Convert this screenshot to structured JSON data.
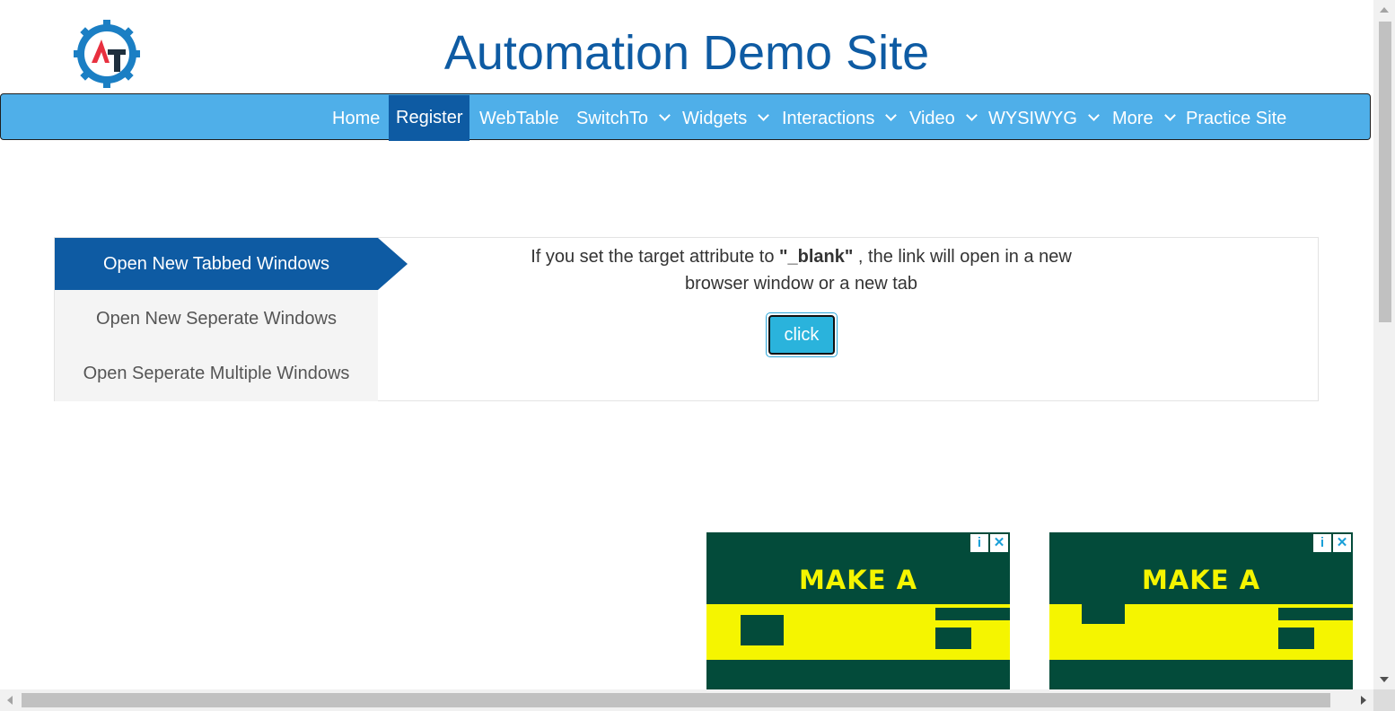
{
  "header": {
    "title": "Automation Demo Site",
    "logo_text": "AT"
  },
  "nav": {
    "items": [
      {
        "label": "Home",
        "dropdown": false,
        "active": false
      },
      {
        "label": "Register",
        "dropdown": false,
        "active": true
      },
      {
        "label": "WebTable",
        "dropdown": false,
        "active": false
      },
      {
        "label": "SwitchTo",
        "dropdown": true,
        "active": false
      },
      {
        "label": "Widgets",
        "dropdown": true,
        "active": false
      },
      {
        "label": "Interactions",
        "dropdown": true,
        "active": false
      },
      {
        "label": "Video",
        "dropdown": true,
        "active": false
      },
      {
        "label": "WYSIWYG",
        "dropdown": true,
        "active": false
      },
      {
        "label": "More",
        "dropdown": true,
        "active": false
      },
      {
        "label": "Practice Site",
        "dropdown": false,
        "active": false
      }
    ]
  },
  "tabs": [
    {
      "label": "Open New Tabbed Windows",
      "active": true
    },
    {
      "label": "Open New Seperate Windows",
      "active": false
    },
    {
      "label": "Open Seperate Multiple Windows",
      "active": false
    }
  ],
  "content": {
    "desc_before": "If you set the target attribute to ",
    "desc_bold": "\"_blank\"",
    "desc_after": " , the link will open in a new browser window or a new tab",
    "button_label": "click"
  },
  "ads": [
    {
      "headline": "MAKE A",
      "info_icon": "i",
      "close_icon": "✕"
    },
    {
      "headline": "MAKE A",
      "info_icon": "i",
      "close_icon": "✕"
    }
  ],
  "colors": {
    "brand": "#0e5ba3",
    "navbar": "#4fafe9",
    "button": "#2ab3dc",
    "ad_bg": "#034b3a",
    "ad_accent": "#f5f500"
  }
}
